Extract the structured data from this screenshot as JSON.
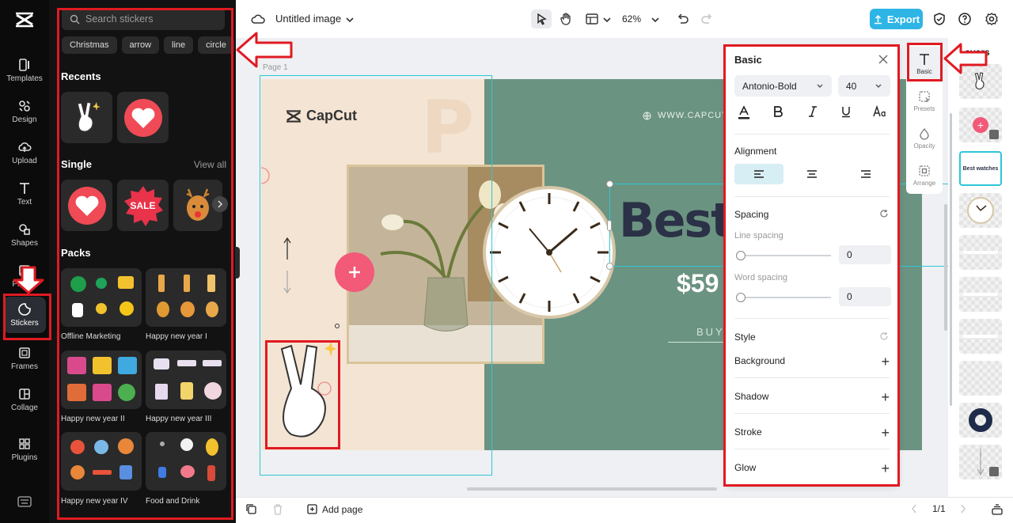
{
  "rail": {
    "items": [
      {
        "label": "Templates"
      },
      {
        "label": "Design"
      },
      {
        "label": "Upload"
      },
      {
        "label": "Text"
      },
      {
        "label": "Shapes"
      },
      {
        "label": "Photos"
      },
      {
        "label": "Stickers"
      },
      {
        "label": "Frames"
      },
      {
        "label": "Collage"
      },
      {
        "label": "Plugins"
      }
    ]
  },
  "stickers": {
    "search_placeholder": "Search stickers",
    "chips": [
      "Christmas",
      "arrow",
      "line",
      "circle"
    ],
    "recents_title": "Recents",
    "single_title": "Single",
    "view_all": "View all",
    "sale_text": "SALE",
    "packs_title": "Packs",
    "packs": [
      {
        "label": "Offline Marketing"
      },
      {
        "label": "Happy new year I"
      },
      {
        "label": "Happy new year II"
      },
      {
        "label": "Happy new year III"
      },
      {
        "label": "Happy new year IV"
      },
      {
        "label": "Food and Drink"
      }
    ]
  },
  "topbar": {
    "title": "Untitled image",
    "zoom": "62%",
    "export_label": "Export"
  },
  "canvas": {
    "page_label": "Page 1",
    "brand": "CapCut",
    "url": "WWW.CAPCUT",
    "headline": "Best w",
    "price": "$59",
    "buy": "BUY",
    "bg_letters": "PRE"
  },
  "props": {
    "title": "Basic",
    "font": "Antonio-Bold",
    "size": "40",
    "alignment_title": "Alignment",
    "spacing_title": "Spacing",
    "line_spacing_label": "Line spacing",
    "line_spacing_value": "0",
    "word_spacing_label": "Word spacing",
    "word_spacing_value": "0",
    "style_title": "Style",
    "rows": [
      {
        "label": "Background"
      },
      {
        "label": "Shadow"
      },
      {
        "label": "Stroke"
      },
      {
        "label": "Glow"
      }
    ]
  },
  "tools": {
    "items": [
      {
        "label": "Basic"
      },
      {
        "label": "Presets"
      },
      {
        "label": "Opacity"
      },
      {
        "label": "Arrange"
      }
    ]
  },
  "layers": {
    "title": "Layers",
    "text_layer_label": "Best watches"
  },
  "bottombar": {
    "add_page": "Add page",
    "page_count": "1/1"
  },
  "colors": {
    "accent": "#2eb5e6",
    "annotation": "#e01a22",
    "selection": "#2ec6d6",
    "banner_green": "#6b9381",
    "banner_cream": "#f4e4d3"
  }
}
